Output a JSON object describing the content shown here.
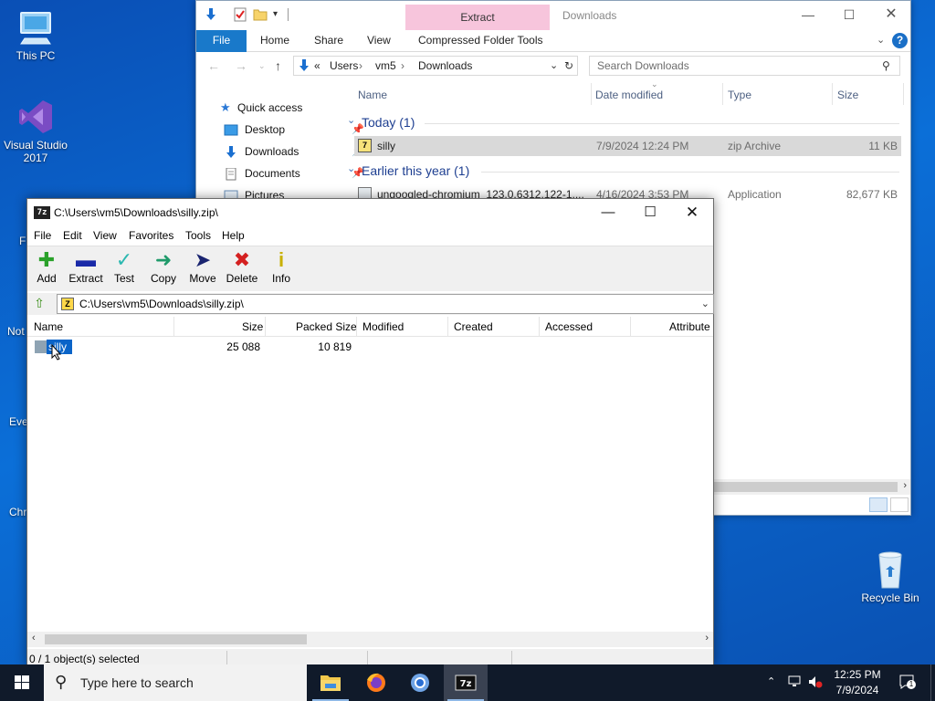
{
  "desktop": {
    "icons": [
      {
        "label": "This PC"
      },
      {
        "label": "Visual Studio 2017"
      },
      {
        "label": "Recycle Bin"
      }
    ],
    "partial_labels": [
      "F",
      "Not",
      "Eve",
      "Chr"
    ]
  },
  "explorer": {
    "window_title": "Downloads",
    "contextual_tab": "Extract",
    "ribbon_tabs": [
      "File",
      "Home",
      "Share",
      "View",
      "Compressed Folder Tools"
    ],
    "breadcrumb": [
      "«",
      "Users",
      "vm5",
      "Downloads"
    ],
    "search_placeholder": "Search Downloads",
    "nav_items": [
      {
        "label": "Quick access",
        "icon": "star-icon"
      },
      {
        "label": "Desktop",
        "icon": "desktop-folder-icon"
      },
      {
        "label": "Downloads",
        "icon": "downloads-arrow-icon"
      },
      {
        "label": "Documents",
        "icon": "documents-icon"
      },
      {
        "label": "Pictures",
        "icon": "pictures-icon"
      }
    ],
    "columns": [
      "Name",
      "Date modified",
      "Type",
      "Size"
    ],
    "groups": [
      {
        "title": "Today (1)",
        "files": [
          {
            "name": "silly",
            "date": "7/9/2024 12:24 PM",
            "type": "zip Archive",
            "size": "11 KB",
            "selected": true
          }
        ]
      },
      {
        "title": "Earlier this year (1)",
        "files": [
          {
            "name": "ungoogled-chromium_123.0.6312.122-1....",
            "date": "4/16/2024 3:53 PM",
            "type": "Application",
            "size": "82,677 KB",
            "selected": false
          }
        ]
      }
    ]
  },
  "sevenzip": {
    "title": "C:\\Users\\vm5\\Downloads\\silly.zip\\",
    "menu": [
      "File",
      "Edit",
      "View",
      "Favorites",
      "Tools",
      "Help"
    ],
    "toolbar": [
      {
        "label": "Add",
        "icon": "add-icon",
        "color": "#2aa12a"
      },
      {
        "label": "Extract",
        "icon": "extract-icon",
        "color": "#1a2aa8"
      },
      {
        "label": "Test",
        "icon": "test-icon",
        "color": "#2bb8b0"
      },
      {
        "label": "Copy",
        "icon": "copy-icon",
        "color": "#1f9a6a"
      },
      {
        "label": "Move",
        "icon": "move-icon",
        "color": "#1a2470"
      },
      {
        "label": "Delete",
        "icon": "delete-icon",
        "color": "#d42020"
      },
      {
        "label": "Info",
        "icon": "info-icon",
        "color": "#c8b000"
      }
    ],
    "path": "C:\\Users\\vm5\\Downloads\\silly.zip\\",
    "columns": [
      "Name",
      "Size",
      "Packed Size",
      "Modified",
      "Created",
      "Accessed",
      "Attribute"
    ],
    "rows": [
      {
        "name": "silly",
        "size": "25 088",
        "packed": "10 819",
        "modified": "",
        "created": "",
        "accessed": "",
        "attributes": ""
      }
    ],
    "status": "0 / 1 object(s) selected"
  },
  "taskbar": {
    "search_placeholder": "Type here to search",
    "time": "12:25 PM",
    "date": "7/9/2024",
    "notification_count": "1"
  }
}
